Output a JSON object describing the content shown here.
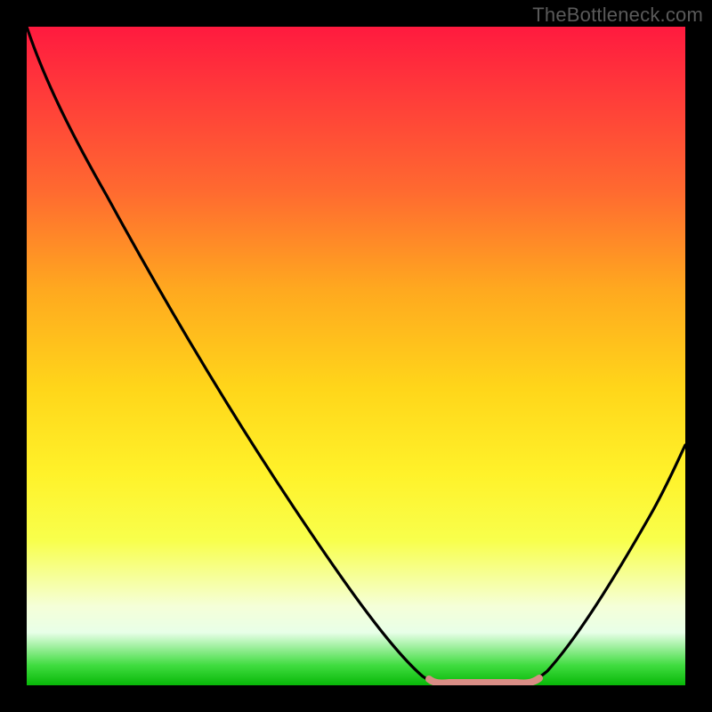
{
  "watermark": "TheBottleneck.com",
  "chart_data": {
    "type": "line",
    "title": "",
    "xlabel": "",
    "ylabel": "",
    "xlim": [
      0,
      100
    ],
    "ylim": [
      0,
      100
    ],
    "series": [
      {
        "name": "bottleneck-curve",
        "x": [
          0,
          5,
          10,
          15,
          20,
          25,
          30,
          35,
          40,
          45,
          50,
          55,
          60,
          63,
          66,
          70,
          73,
          76,
          80,
          84,
          88,
          92,
          96,
          100
        ],
        "y": [
          100,
          92,
          85,
          78,
          71,
          64,
          56,
          48,
          40,
          32,
          24,
          16,
          8,
          2,
          0,
          0,
          0,
          2,
          8,
          16,
          24,
          32,
          40,
          48
        ]
      }
    ],
    "flat_segment": {
      "name": "optimal-zone-marker",
      "color": "#d98d85",
      "x_start": 63,
      "x_end": 76,
      "y": 0.5
    },
    "background_gradient": {
      "top": "#ff1a3f",
      "mid": "#fff22a",
      "bottom": "#08b808"
    }
  }
}
